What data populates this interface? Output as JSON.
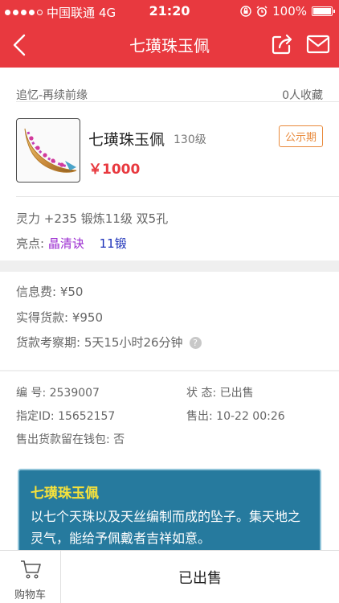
{
  "status_bar": {
    "carrier": "中国联通",
    "network": "4G",
    "time": "21:20",
    "battery": "100%"
  },
  "nav": {
    "title": "七璜珠玉佩"
  },
  "listing": {
    "subtitle": "追忆-再续前缘",
    "favorites": "0人收藏",
    "item_name": "七璜珠玉佩",
    "level": "130级",
    "badge": "公示期",
    "price": "￥1000",
    "attrs": "灵力 +235 锻炼11级 双5孔",
    "highlight_label": "亮点:",
    "highlight_1": "晶清诀",
    "highlight_2": "11锻"
  },
  "fees": {
    "info_fee": "信息费: ¥50",
    "actual": "实得货款: ¥950",
    "review": "货款考察期: 5天15小时26分钟",
    "help_icon": "?"
  },
  "info": {
    "id": "编   号: 2539007",
    "status": "状   态: 已出售",
    "designated": "指定ID: 15652157",
    "sold_at": "售出: 10-22 00:26",
    "wallet": "售出货款留在钱包: 否"
  },
  "description": {
    "title": "七璜珠玉佩",
    "body": "以七个天珠以及天丝编制而成的坠子。集天地之灵气，能给予佩戴者吉祥如意。"
  },
  "bottom": {
    "cart_label": "购物车",
    "sold_label": "已出售"
  },
  "colors": {
    "brand_red": "#e8393f",
    "badge_orange": "#e98a3c",
    "desc_bg": "#267a9e"
  }
}
